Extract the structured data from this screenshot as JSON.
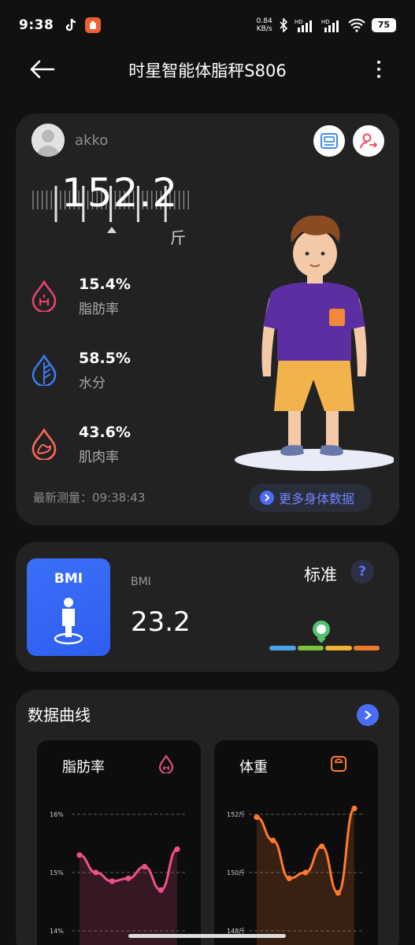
{
  "status_bar": {
    "time": "9:38",
    "net_speed_value": "0.84",
    "net_speed_unit": "KB/s",
    "battery": "75"
  },
  "header": {
    "title": "时星智能体脂秤S806"
  },
  "profile": {
    "username": "akko",
    "weight": "152.2",
    "weight_unit": "斤",
    "metrics": [
      {
        "value": "15.4%",
        "label": "脂肪率",
        "color": "#e8436e"
      },
      {
        "value": "58.5%",
        "label": "水分",
        "color": "#3b7cf0"
      },
      {
        "value": "43.6%",
        "label": "肌肉率",
        "color": "#ff6a55"
      }
    ],
    "last_measure": "最新测量：09:38:43",
    "more_data_label": "更多身体数据"
  },
  "bmi": {
    "tile_title": "BMI",
    "label": "BMI",
    "value": "23.2",
    "status": "标准",
    "help": "?",
    "scale_colors": [
      "#4aa3e8",
      "#7cc23a",
      "#f2b233",
      "#f07a2a"
    ]
  },
  "curves": {
    "title": "数据曲线",
    "cards": [
      {
        "title": "脂肪率",
        "color": "#f0508a"
      },
      {
        "title": "体重",
        "color": "#ff7a2e"
      }
    ]
  },
  "chart_data": [
    {
      "type": "line",
      "title": "脂肪率",
      "y_tick_labels": [
        "16%",
        "15%",
        "14%"
      ],
      "ylim": [
        14,
        16
      ],
      "values": [
        15.3,
        15.0,
        14.85,
        14.9,
        15.1,
        14.7,
        15.4
      ]
    },
    {
      "type": "line",
      "title": "体重",
      "y_tick_labels": [
        "152斤",
        "150斤",
        "148斤"
      ],
      "ylim": [
        148,
        152
      ],
      "values": [
        151.9,
        151.1,
        149.8,
        150.0,
        150.9,
        149.3,
        152.2
      ]
    }
  ]
}
